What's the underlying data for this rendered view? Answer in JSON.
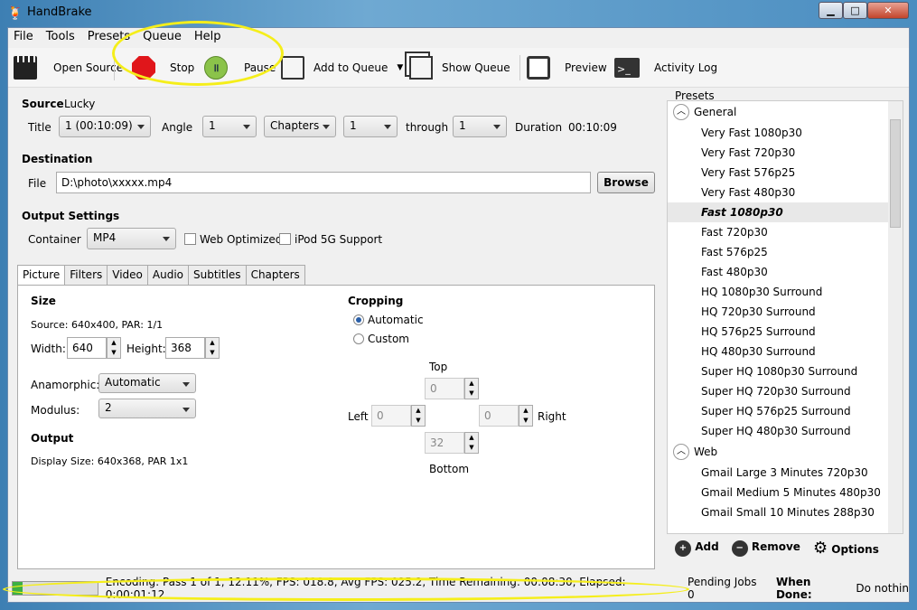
{
  "window": {
    "title": "HandBrake",
    "minimize": "▁",
    "maximize": "□",
    "close": "✕"
  },
  "menu": [
    "File",
    "Tools",
    "Presets",
    "Queue",
    "Help"
  ],
  "toolbar": {
    "open_source": "Open Source",
    "stop": "Stop",
    "pause": "Pause",
    "add_to_queue": "Add to Queue",
    "show_queue": "Show Queue",
    "preview": "Preview",
    "activity_log": "Activity Log"
  },
  "source": {
    "label": "Source",
    "value": "Lucky",
    "title_label": "Title",
    "title_value": "1 (00:10:09)",
    "angle_label": "Angle",
    "angle_value": "1",
    "mode_value": "Chapters",
    "from_value": "1",
    "through_label": "through",
    "to_value": "1",
    "duration_label": "Duration",
    "duration_value": "00:10:09"
  },
  "destination": {
    "label": "Destination",
    "file_label": "File",
    "file_value": "D:\\photo\\xxxxx.mp4",
    "browse": "Browse"
  },
  "output": {
    "label": "Output Settings",
    "container_label": "Container",
    "container_value": "MP4",
    "web_optimized": "Web Optimized",
    "ipod": "iPod 5G Support"
  },
  "tabs": [
    "Picture",
    "Filters",
    "Video",
    "Audio",
    "Subtitles",
    "Chapters"
  ],
  "picture": {
    "size_label": "Size",
    "source_info": "Source:  640x400, PAR: 1/1",
    "width_label": "Width:",
    "width_value": "640",
    "height_label": "Height:",
    "height_value": "368",
    "anamorphic_label": "Anamorphic:",
    "anamorphic_value": "Automatic",
    "modulus_label": "Modulus:",
    "modulus_value": "2",
    "output_label": "Output",
    "display_size": "Display Size: 640x368,  PAR 1x1",
    "cropping_label": "Cropping",
    "automatic": "Automatic",
    "custom": "Custom",
    "top_label": "Top",
    "top_value": "0",
    "left_label": "Left",
    "left_value": "0",
    "right_label": "Right",
    "right_value": "0",
    "bottom_label": "Bottom",
    "bottom_value": "32"
  },
  "presets": {
    "label": "Presets",
    "groups": [
      {
        "name": "General",
        "items": [
          "Very Fast 1080p30",
          "Very Fast 720p30",
          "Very Fast 576p25",
          "Very Fast 480p30",
          "Fast 1080p30",
          "Fast 720p30",
          "Fast 576p25",
          "Fast 480p30",
          "HQ 1080p30 Surround",
          "HQ 720p30 Surround",
          "HQ 576p25 Surround",
          "HQ 480p30 Surround",
          "Super HQ 1080p30 Surround",
          "Super HQ 720p30 Surround",
          "Super HQ 576p25 Surround",
          "Super HQ 480p30 Surround"
        ]
      },
      {
        "name": "Web",
        "items": [
          "Gmail Large 3 Minutes 720p30",
          "Gmail Medium 5 Minutes 480p30",
          "Gmail Small 10 Minutes 288p30"
        ]
      }
    ],
    "selected": "Fast 1080p30",
    "add": "Add",
    "remove": "Remove",
    "options": "Options"
  },
  "status": {
    "progress_percent": 12.11,
    "encoding": "Encoding: Pass 1 of 1,  12.11%, FPS: 018.8,  Avg FPS: 025.2,  Time Remaining: 00:08:30,  Elapsed: 0:00:01:12",
    "pending": "Pending Jobs 0",
    "when_done_label": "When Done:",
    "when_done_value": "Do nothin"
  }
}
